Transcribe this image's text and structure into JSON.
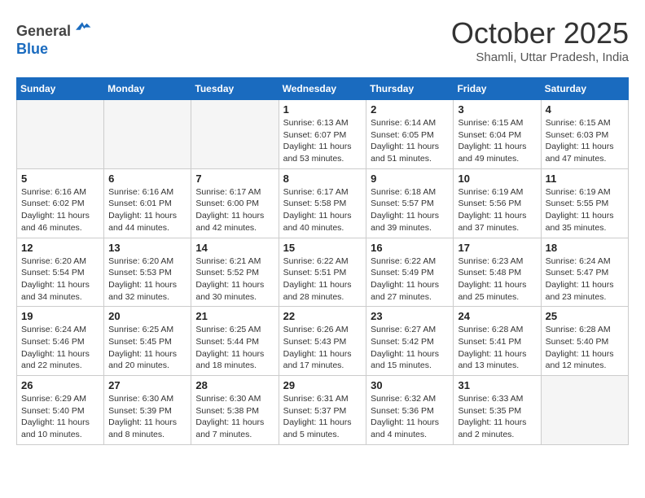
{
  "header": {
    "logo_line1": "General",
    "logo_line2": "Blue",
    "month": "October 2025",
    "location": "Shamli, Uttar Pradesh, India"
  },
  "weekdays": [
    "Sunday",
    "Monday",
    "Tuesday",
    "Wednesday",
    "Thursday",
    "Friday",
    "Saturday"
  ],
  "weeks": [
    [
      {
        "day": "",
        "info": ""
      },
      {
        "day": "",
        "info": ""
      },
      {
        "day": "",
        "info": ""
      },
      {
        "day": "1",
        "info": "Sunrise: 6:13 AM\nSunset: 6:07 PM\nDaylight: 11 hours\nand 53 minutes."
      },
      {
        "day": "2",
        "info": "Sunrise: 6:14 AM\nSunset: 6:05 PM\nDaylight: 11 hours\nand 51 minutes."
      },
      {
        "day": "3",
        "info": "Sunrise: 6:15 AM\nSunset: 6:04 PM\nDaylight: 11 hours\nand 49 minutes."
      },
      {
        "day": "4",
        "info": "Sunrise: 6:15 AM\nSunset: 6:03 PM\nDaylight: 11 hours\nand 47 minutes."
      }
    ],
    [
      {
        "day": "5",
        "info": "Sunrise: 6:16 AM\nSunset: 6:02 PM\nDaylight: 11 hours\nand 46 minutes."
      },
      {
        "day": "6",
        "info": "Sunrise: 6:16 AM\nSunset: 6:01 PM\nDaylight: 11 hours\nand 44 minutes."
      },
      {
        "day": "7",
        "info": "Sunrise: 6:17 AM\nSunset: 6:00 PM\nDaylight: 11 hours\nand 42 minutes."
      },
      {
        "day": "8",
        "info": "Sunrise: 6:17 AM\nSunset: 5:58 PM\nDaylight: 11 hours\nand 40 minutes."
      },
      {
        "day": "9",
        "info": "Sunrise: 6:18 AM\nSunset: 5:57 PM\nDaylight: 11 hours\nand 39 minutes."
      },
      {
        "day": "10",
        "info": "Sunrise: 6:19 AM\nSunset: 5:56 PM\nDaylight: 11 hours\nand 37 minutes."
      },
      {
        "day": "11",
        "info": "Sunrise: 6:19 AM\nSunset: 5:55 PM\nDaylight: 11 hours\nand 35 minutes."
      }
    ],
    [
      {
        "day": "12",
        "info": "Sunrise: 6:20 AM\nSunset: 5:54 PM\nDaylight: 11 hours\nand 34 minutes."
      },
      {
        "day": "13",
        "info": "Sunrise: 6:20 AM\nSunset: 5:53 PM\nDaylight: 11 hours\nand 32 minutes."
      },
      {
        "day": "14",
        "info": "Sunrise: 6:21 AM\nSunset: 5:52 PM\nDaylight: 11 hours\nand 30 minutes."
      },
      {
        "day": "15",
        "info": "Sunrise: 6:22 AM\nSunset: 5:51 PM\nDaylight: 11 hours\nand 28 minutes."
      },
      {
        "day": "16",
        "info": "Sunrise: 6:22 AM\nSunset: 5:49 PM\nDaylight: 11 hours\nand 27 minutes."
      },
      {
        "day": "17",
        "info": "Sunrise: 6:23 AM\nSunset: 5:48 PM\nDaylight: 11 hours\nand 25 minutes."
      },
      {
        "day": "18",
        "info": "Sunrise: 6:24 AM\nSunset: 5:47 PM\nDaylight: 11 hours\nand 23 minutes."
      }
    ],
    [
      {
        "day": "19",
        "info": "Sunrise: 6:24 AM\nSunset: 5:46 PM\nDaylight: 11 hours\nand 22 minutes."
      },
      {
        "day": "20",
        "info": "Sunrise: 6:25 AM\nSunset: 5:45 PM\nDaylight: 11 hours\nand 20 minutes."
      },
      {
        "day": "21",
        "info": "Sunrise: 6:25 AM\nSunset: 5:44 PM\nDaylight: 11 hours\nand 18 minutes."
      },
      {
        "day": "22",
        "info": "Sunrise: 6:26 AM\nSunset: 5:43 PM\nDaylight: 11 hours\nand 17 minutes."
      },
      {
        "day": "23",
        "info": "Sunrise: 6:27 AM\nSunset: 5:42 PM\nDaylight: 11 hours\nand 15 minutes."
      },
      {
        "day": "24",
        "info": "Sunrise: 6:28 AM\nSunset: 5:41 PM\nDaylight: 11 hours\nand 13 minutes."
      },
      {
        "day": "25",
        "info": "Sunrise: 6:28 AM\nSunset: 5:40 PM\nDaylight: 11 hours\nand 12 minutes."
      }
    ],
    [
      {
        "day": "26",
        "info": "Sunrise: 6:29 AM\nSunset: 5:40 PM\nDaylight: 11 hours\nand 10 minutes."
      },
      {
        "day": "27",
        "info": "Sunrise: 6:30 AM\nSunset: 5:39 PM\nDaylight: 11 hours\nand 8 minutes."
      },
      {
        "day": "28",
        "info": "Sunrise: 6:30 AM\nSunset: 5:38 PM\nDaylight: 11 hours\nand 7 minutes."
      },
      {
        "day": "29",
        "info": "Sunrise: 6:31 AM\nSunset: 5:37 PM\nDaylight: 11 hours\nand 5 minutes."
      },
      {
        "day": "30",
        "info": "Sunrise: 6:32 AM\nSunset: 5:36 PM\nDaylight: 11 hours\nand 4 minutes."
      },
      {
        "day": "31",
        "info": "Sunrise: 6:33 AM\nSunset: 5:35 PM\nDaylight: 11 hours\nand 2 minutes."
      },
      {
        "day": "",
        "info": ""
      }
    ]
  ]
}
